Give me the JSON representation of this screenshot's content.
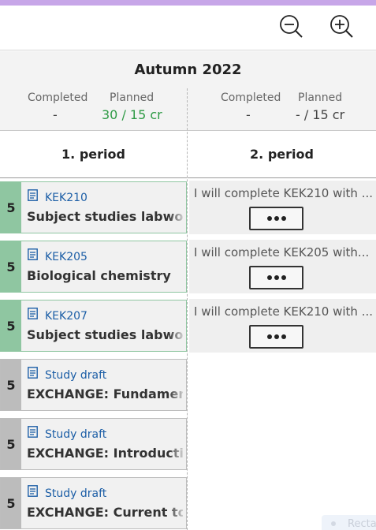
{
  "term": {
    "title": "Autumn 2022",
    "left": {
      "completed_label": "Completed",
      "completed_value": "-",
      "planned_label": "Planned",
      "planned_value": "30 / 15 cr"
    },
    "right": {
      "completed_label": "Completed",
      "completed_value": "-",
      "planned_label": "Planned",
      "planned_value": "- / 15 cr"
    }
  },
  "periods": [
    "1. period",
    "2. period"
  ],
  "courses": [
    {
      "credits": "5",
      "code": "KEK210",
      "name": "Subject studies labworks",
      "status": "green"
    },
    {
      "credits": "5",
      "code": "KEK205",
      "name": "Biological chemistry",
      "status": "green"
    },
    {
      "credits": "5",
      "code": "KEK207",
      "name": "Subject studies labworks",
      "status": "green"
    },
    {
      "credits": "5",
      "code": "Study draft",
      "name": "EXCHANGE: Fundamentals",
      "status": "grey"
    },
    {
      "credits": "5",
      "code": "Study draft",
      "name": "EXCHANGE: Introduction",
      "status": "grey"
    },
    {
      "credits": "5",
      "code": "Study draft",
      "name": "EXCHANGE: Current topics",
      "status": "grey"
    }
  ],
  "notes": [
    {
      "text": "I will complete KEK210 with ..."
    },
    {
      "text": "I will complete KEK205 with..."
    },
    {
      "text": "I will complete KEK210 with ..."
    }
  ],
  "legend": {
    "label": "Recta"
  },
  "icons": {
    "zoom_out": "zoom-out-icon",
    "zoom_in": "zoom-in-icon",
    "course": "document-icon",
    "more": "more-dots-icon"
  },
  "colors": {
    "accent_bar": "#c7a6e8",
    "completed_green": "#8fc6a1",
    "planned_green_text": "#2e9a45",
    "draft_grey": "#bcbcbc",
    "link_blue": "#1c5ea6"
  }
}
